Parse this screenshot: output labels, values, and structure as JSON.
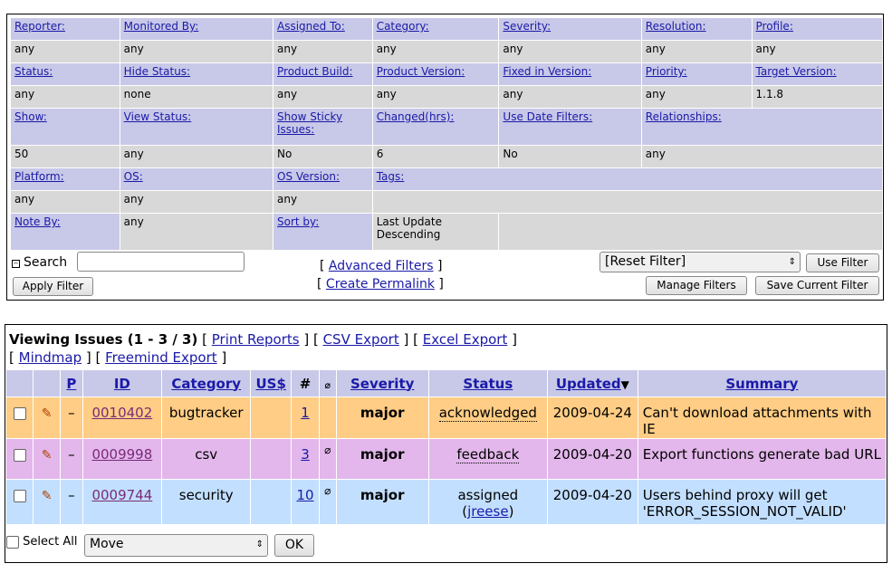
{
  "filters": {
    "rows": [
      {
        "labels": [
          "Reporter:",
          "Monitored By:",
          "Assigned To:",
          "Category:",
          "Severity:",
          "Resolution:",
          "Profile:"
        ],
        "values": [
          "any",
          "any",
          "any",
          "any",
          "any",
          "any",
          "any"
        ]
      },
      {
        "labels": [
          "Status:",
          "Hide Status:",
          "Product Build:",
          "Product Version:",
          "Fixed in Version:",
          "Priority:",
          "Target Version:"
        ],
        "values": [
          "any",
          "none",
          "any",
          "any",
          "any",
          "any",
          "1.1.8"
        ]
      },
      {
        "labels": [
          "Show:",
          "View Status:",
          "Show Sticky Issues:",
          "Changed(hrs):",
          "Use Date Filters:",
          "Relationships:"
        ],
        "values": [
          "50",
          "any",
          "No",
          "6",
          "No",
          "any"
        ]
      },
      {
        "labels": [
          "Platform:",
          "OS:",
          "OS Version:",
          "Tags:"
        ],
        "values": [
          "any",
          "any",
          "any",
          ""
        ]
      },
      {
        "labels": [
          "Note By:",
          "any",
          "Sort by:",
          "Last Update Descending"
        ]
      }
    ],
    "search_label": "Search",
    "search_value": "",
    "apply_filter": "Apply Filter",
    "advanced_filters": "Advanced Filters",
    "create_permalink": "Create Permalink",
    "reset_filter": "[Reset Filter]",
    "use_filter": "Use Filter",
    "manage_filters": "Manage Filters",
    "save_current_filter": "Save Current Filter"
  },
  "issues": {
    "title": "Viewing Issues (1 - 3 / 3)",
    "print_reports": "Print Reports",
    "csv_export": "CSV Export",
    "excel_export": "Excel Export",
    "mindmap": "Mindmap",
    "freemind_export": "Freemind Export",
    "columns": [
      "P",
      "ID",
      "Category",
      "US$",
      "#",
      "Severity",
      "Status",
      "Updated",
      "Summary"
    ],
    "rows": [
      {
        "priority": "–",
        "id": "0010402",
        "category": "bugtracker",
        "notes": "1",
        "attachment": false,
        "severity": "major",
        "status": "acknowledged",
        "assignee": "",
        "updated": "2009-04-24",
        "summary": "Can't download attachments with IE",
        "color": "#ffcd85"
      },
      {
        "priority": "–",
        "id": "0009998",
        "category": "csv",
        "notes": "3",
        "attachment": true,
        "severity": "major",
        "status": "feedback",
        "assignee": "",
        "updated": "2009-04-20",
        "summary": "Export functions generate bad URL",
        "color": "#e3b7eb"
      },
      {
        "priority": "–",
        "id": "0009744",
        "category": "security",
        "notes": "10",
        "attachment": true,
        "severity": "major",
        "status": "assigned",
        "assignee": "jreese",
        "updated": "2009-04-20",
        "summary": "Users behind proxy will get 'ERROR_SESSION_NOT_VALID'",
        "color": "#c2dfff"
      }
    ],
    "select_all": "Select All",
    "action_select": "Move",
    "ok": "OK"
  }
}
